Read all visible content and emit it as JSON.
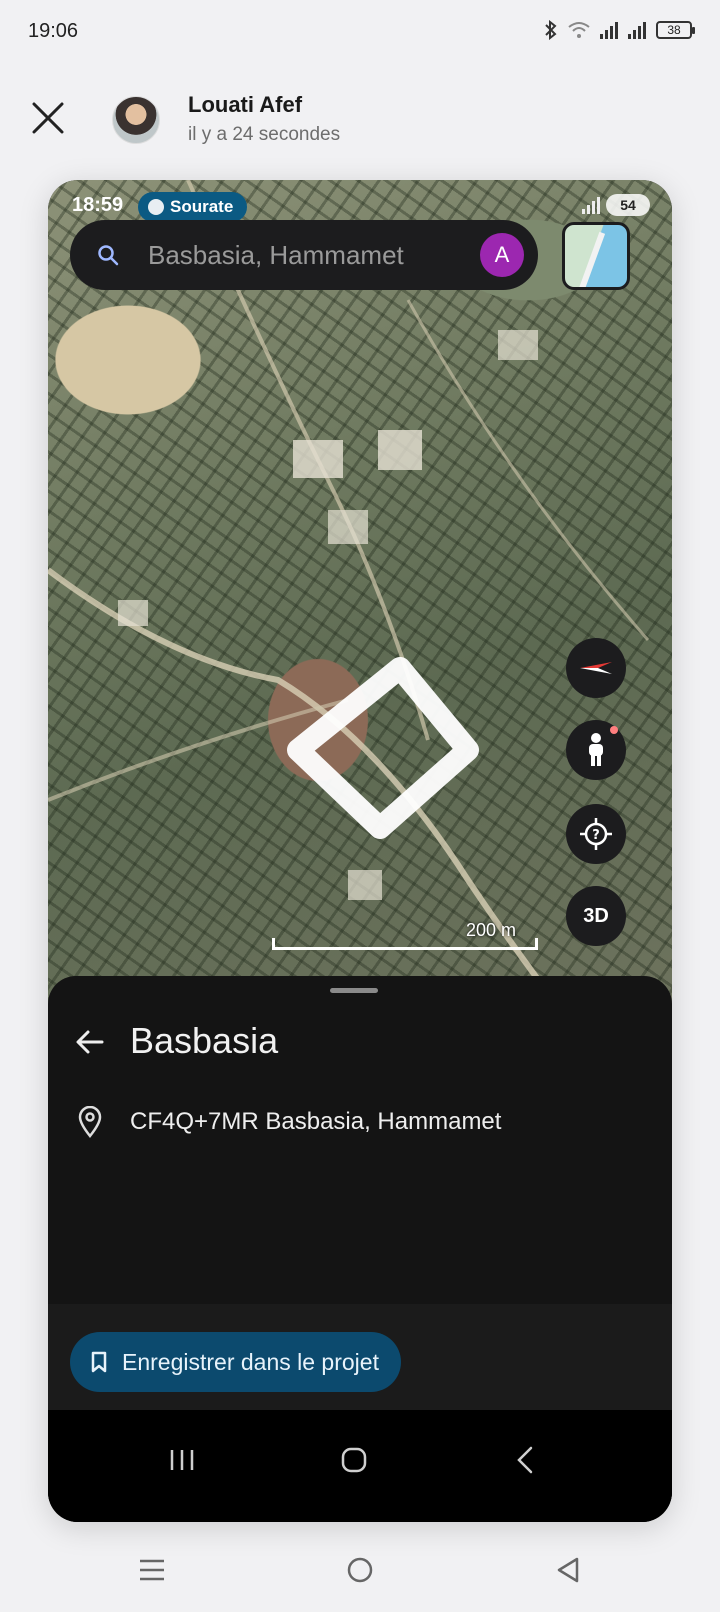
{
  "outer_status": {
    "time": "19:06",
    "battery": "38"
  },
  "sender": {
    "name": "Louati Afef",
    "time_ago": "il y a 24 secondes"
  },
  "inner_status": {
    "time": "18:59",
    "pill_label": "Sourate",
    "battery": "54"
  },
  "search": {
    "text": "Basbasia, Hammamet",
    "account_initial": "A"
  },
  "map": {
    "scale_label": "200 m",
    "three_d_label": "3D"
  },
  "place": {
    "title": "Basbasia",
    "plus_code": "CF4Q+7MR Basbasia, Hammamet",
    "save_label": "Enregistrer dans le projet"
  },
  "colors": {
    "save_button": "#0c4a6e",
    "account_avatar": "#9c27b0",
    "sheet_bg": "#141414",
    "pill_bg": "#0b5a83"
  },
  "icons": [
    "close-icon",
    "bluetooth-icon",
    "wifi-icon",
    "signal-icon",
    "battery-icon",
    "search-icon",
    "compass-icon",
    "pegman-icon",
    "locate-icon",
    "back-arrow-icon",
    "location-pin-icon",
    "bookmark-icon",
    "recents-icon",
    "home-icon",
    "back-icon"
  ]
}
